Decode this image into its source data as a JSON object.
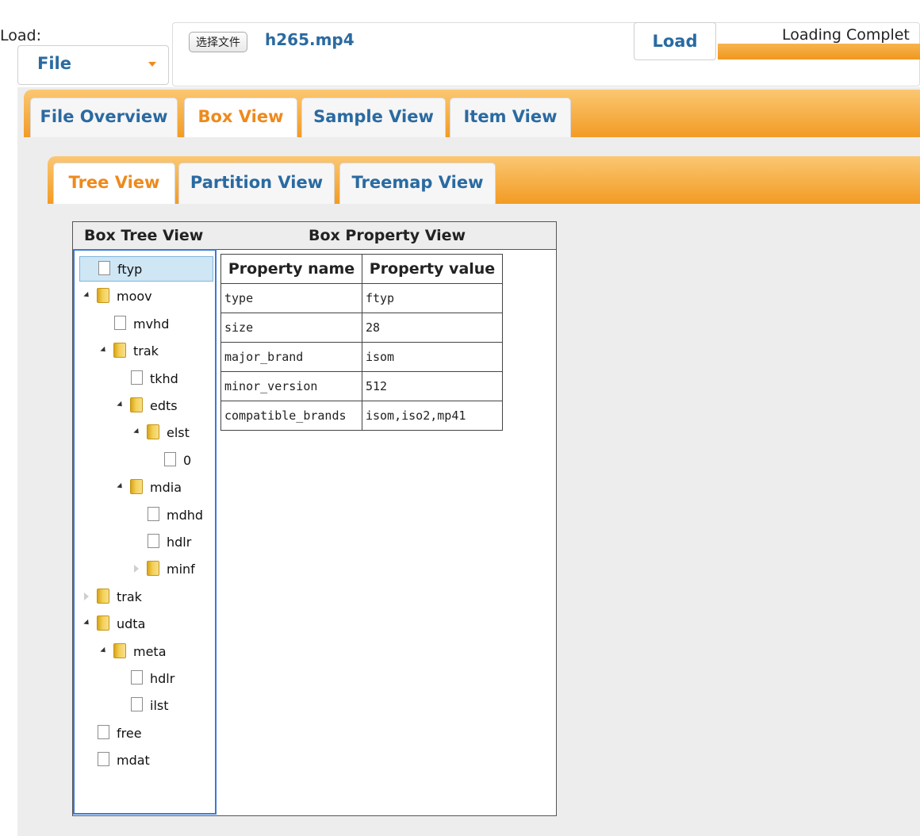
{
  "load": {
    "label": "Load:",
    "source_select": "File",
    "choose_button": "选择文件",
    "file_name": "h265.mp4",
    "load_button": "Load",
    "status": "Loading Complet",
    "progress": 1.0
  },
  "main_tabs": [
    {
      "label": "File Overview",
      "active": false
    },
    {
      "label": "Box View",
      "active": true
    },
    {
      "label": "Sample View",
      "active": false
    },
    {
      "label": "Item View",
      "active": false
    }
  ],
  "sub_tabs": [
    {
      "label": "Tree View",
      "active": true
    },
    {
      "label": "Partition View",
      "active": false
    },
    {
      "label": "Treemap View",
      "active": false
    }
  ],
  "box_view": {
    "tree_header": "Box Tree View",
    "property_header": "Box Property View"
  },
  "tree": [
    {
      "label": "ftyp",
      "depth": 0,
      "type": "file",
      "selected": true
    },
    {
      "label": "moov",
      "depth": 0,
      "type": "folder",
      "expanded": true
    },
    {
      "label": "mvhd",
      "depth": 1,
      "type": "file"
    },
    {
      "label": "trak",
      "depth": 1,
      "type": "folder",
      "expanded": true
    },
    {
      "label": "tkhd",
      "depth": 2,
      "type": "file"
    },
    {
      "label": "edts",
      "depth": 2,
      "type": "folder",
      "expanded": true
    },
    {
      "label": "elst",
      "depth": 3,
      "type": "folder",
      "expanded": true
    },
    {
      "label": "0",
      "depth": 4,
      "type": "file"
    },
    {
      "label": "mdia",
      "depth": 2,
      "type": "folder",
      "expanded": true
    },
    {
      "label": "mdhd",
      "depth": 3,
      "type": "file"
    },
    {
      "label": "hdlr",
      "depth": 3,
      "type": "file"
    },
    {
      "label": "minf",
      "depth": 3,
      "type": "folder",
      "expanded": false
    },
    {
      "label": "trak",
      "depth": 0,
      "type": "folder",
      "expanded": false
    },
    {
      "label": "udta",
      "depth": 0,
      "type": "folder",
      "expanded": true
    },
    {
      "label": "meta",
      "depth": 1,
      "type": "folder",
      "expanded": true
    },
    {
      "label": "hdlr",
      "depth": 2,
      "type": "file"
    },
    {
      "label": "ilst",
      "depth": 2,
      "type": "file"
    },
    {
      "label": "free",
      "depth": 0,
      "type": "file"
    },
    {
      "label": "mdat",
      "depth": 0,
      "type": "file"
    }
  ],
  "properties": {
    "columns": [
      "Property name",
      "Property value"
    ],
    "rows": [
      [
        "type",
        "ftyp"
      ],
      [
        "size",
        "28"
      ],
      [
        "major_brand",
        "isom"
      ],
      [
        "minor_version",
        "512"
      ],
      [
        "compatible_brands",
        "isom,iso2,mp41"
      ]
    ]
  },
  "colors": {
    "accent_orange": "#f29b24",
    "link_blue": "#2a6aa1",
    "active_tab_orange": "#ee8a1c",
    "tree_border_blue": "#3a7bd5"
  }
}
